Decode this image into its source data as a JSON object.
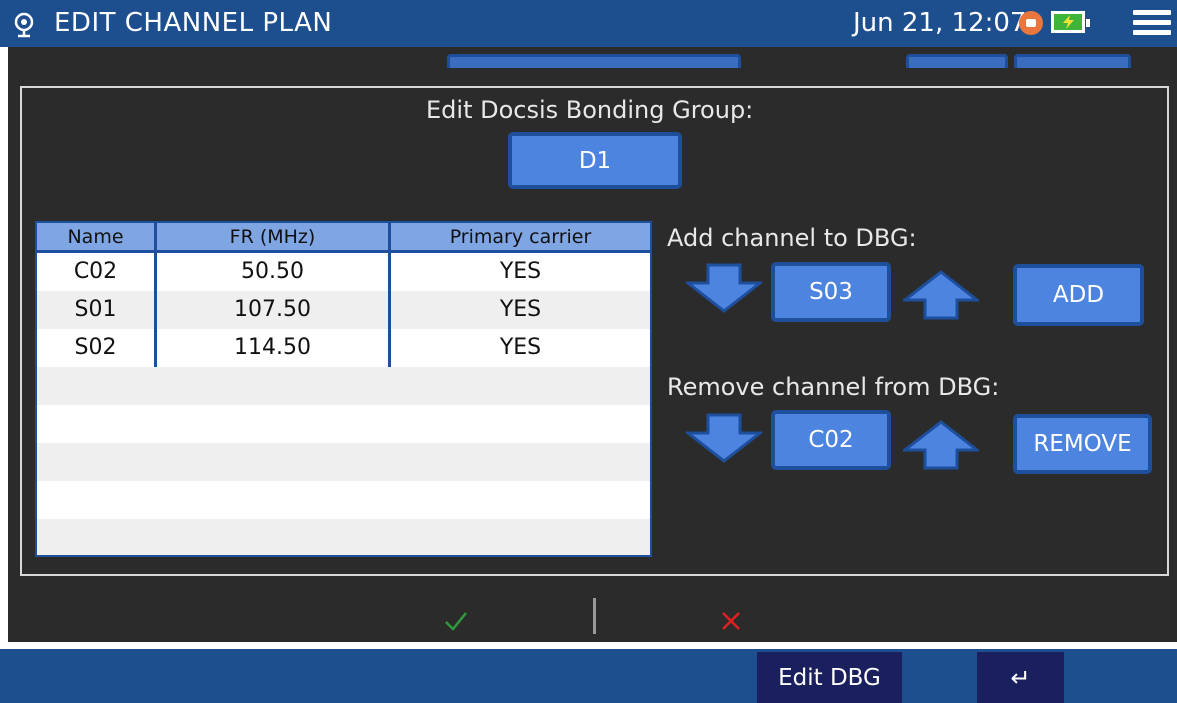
{
  "header": {
    "title": "EDIT CHANNEL PLAN",
    "datetime": "Jun 21, 12:07",
    "icons": [
      "app-icon",
      "record-icon",
      "battery-charging-icon",
      "menu-icon"
    ],
    "color": "#1d4f8f"
  },
  "dbg": {
    "heading": "Edit Docsis Bonding Group:",
    "selected": "D1"
  },
  "table": {
    "columns": [
      "Name",
      "FR (MHz)",
      "Primary carrier"
    ],
    "rows": [
      {
        "name": "C02",
        "fr": "50.50",
        "primary": "YES"
      },
      {
        "name": "S01",
        "fr": "107.50",
        "primary": "YES"
      },
      {
        "name": "S02",
        "fr": "114.50",
        "primary": "YES"
      }
    ]
  },
  "add": {
    "label": "Add channel to DBG:",
    "value": "S03",
    "button": "ADD"
  },
  "remove": {
    "label": "Remove channel from DBG:",
    "value": "C02",
    "button": "REMOVE"
  },
  "confirm": {
    "ok_icon": "checkmark-icon",
    "cancel_icon": "x-icon",
    "ok_color": "#2e9a3a",
    "cancel_color": "#e02020"
  },
  "footer": {
    "edit_dbg": "Edit DBG",
    "back": "↵"
  },
  "colors": {
    "button": "#4d84e0",
    "button_border": "#1e4f9c",
    "table_header": "#7fa5e3",
    "background": "#2b2b2b"
  }
}
